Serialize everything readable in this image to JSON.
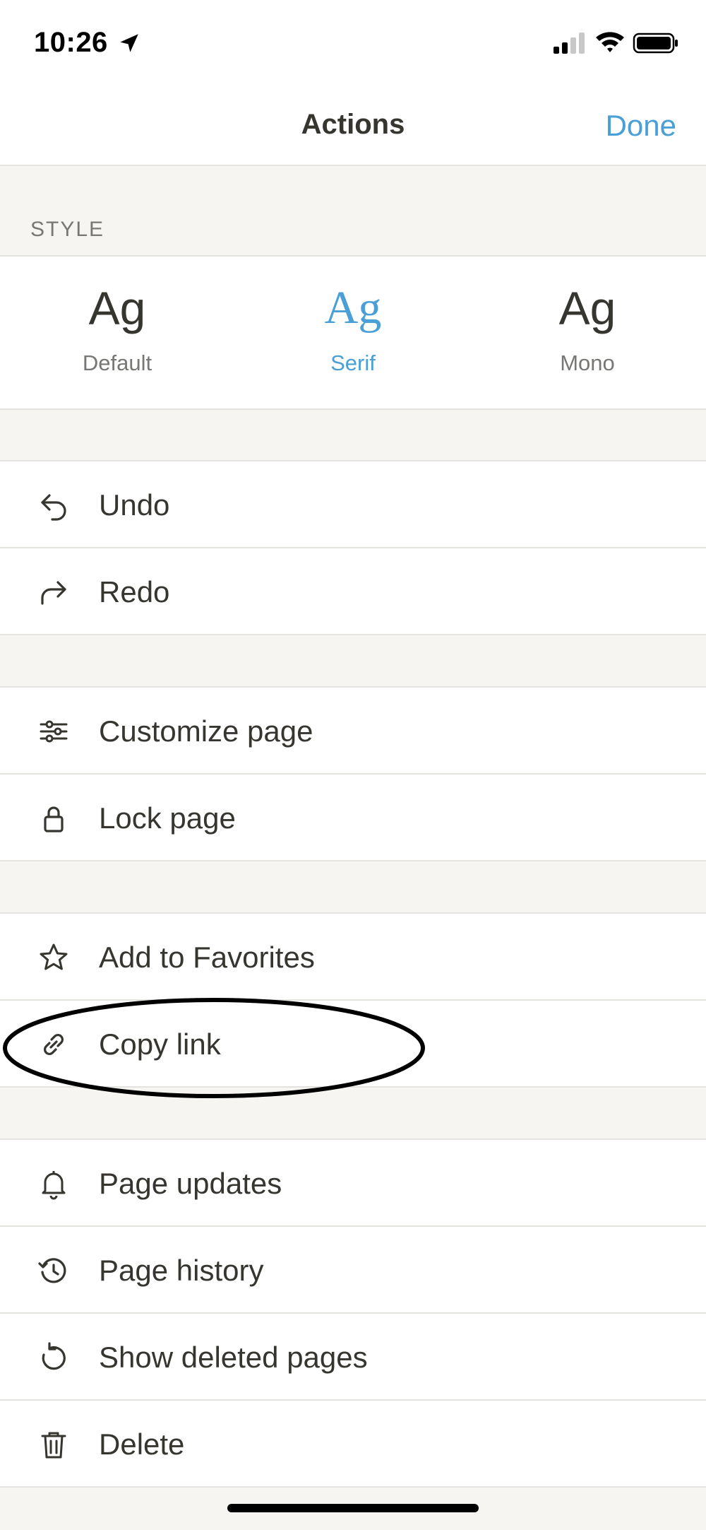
{
  "status_bar": {
    "time": "10:26",
    "icons": [
      "location-arrow-icon",
      "cellular-signal-icon",
      "wifi-icon",
      "battery-icon"
    ]
  },
  "nav": {
    "title": "Actions",
    "done_label": "Done"
  },
  "style_section": {
    "label": "STYLE",
    "options": [
      {
        "sample": "Ag",
        "name": "Default",
        "selected": false
      },
      {
        "sample": "Ag",
        "name": "Serif",
        "selected": true
      },
      {
        "sample": "Ag",
        "name": "Mono",
        "selected": false
      }
    ]
  },
  "groups": [
    [
      {
        "label": "Undo",
        "icon": "undo-icon"
      },
      {
        "label": "Redo",
        "icon": "redo-icon"
      }
    ],
    [
      {
        "label": "Customize page",
        "icon": "sliders-icon"
      },
      {
        "label": "Lock page",
        "icon": "lock-icon"
      }
    ],
    [
      {
        "label": "Add to Favorites",
        "icon": "star-icon"
      },
      {
        "label": "Copy link",
        "icon": "link-icon"
      }
    ],
    [
      {
        "label": "Page updates",
        "icon": "bell-icon"
      },
      {
        "label": "Page history",
        "icon": "history-icon"
      },
      {
        "label": "Show deleted pages",
        "icon": "restore-icon"
      },
      {
        "label": "Delete",
        "icon": "trash-icon"
      }
    ]
  ],
  "colors": {
    "accent": "#4a9fd6",
    "text": "#37352f",
    "muted": "#787774",
    "background": "#f6f5f2",
    "separator": "#e4e3df"
  }
}
